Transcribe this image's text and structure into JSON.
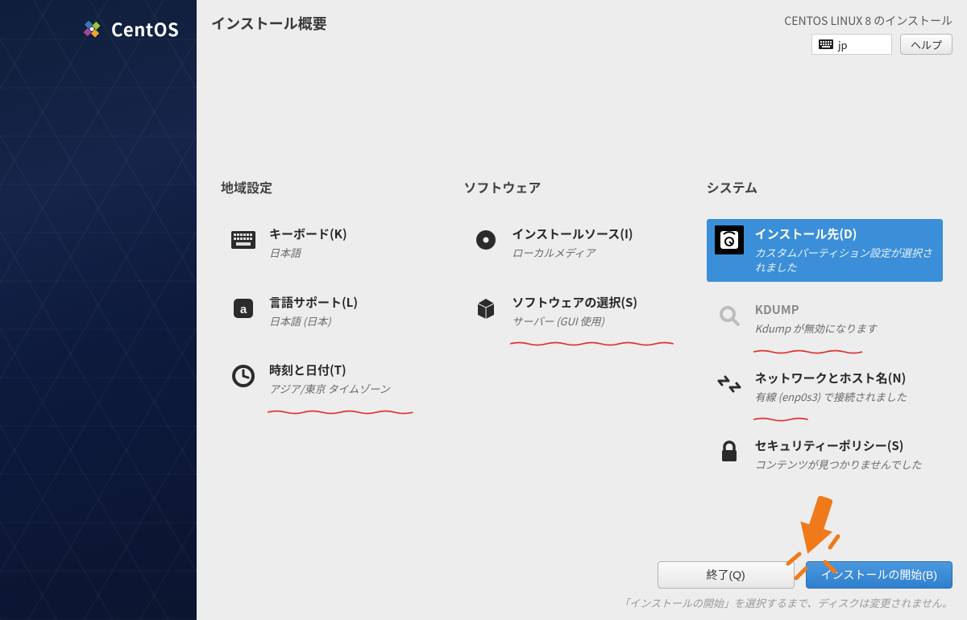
{
  "brand": {
    "name": "CentOS"
  },
  "header": {
    "title": "インストール概要",
    "distro": "CENTOS LINUX 8 のインストール",
    "keyboard_indicator": "jp",
    "help_label": "ヘルプ"
  },
  "columns": {
    "localization": {
      "heading": "地域設定",
      "keyboard": {
        "title": "キーボード(K)",
        "status": "日本語"
      },
      "language": {
        "title": "言語サポート(L)",
        "status": "日本語 (日本)"
      },
      "datetime": {
        "title": "時刻と日付(T)",
        "status": "アジア/東京 タイムゾーン"
      }
    },
    "software": {
      "heading": "ソフトウェア",
      "source": {
        "title": "インストールソース(I)",
        "status": "ローカルメディア"
      },
      "selection": {
        "title": "ソフトウェアの選択(S)",
        "status": "サーバー (GUI 使用)"
      }
    },
    "system": {
      "heading": "システム",
      "destination": {
        "title": "インストール先(D)",
        "status": "カスタムパーティション設定が選択されました"
      },
      "kdump": {
        "title": "KDUMP",
        "status": "Kdump が無効になります"
      },
      "network": {
        "title": "ネットワークとホスト名(N)",
        "status": "有線 (enp0s3) で接続されました"
      },
      "security": {
        "title": "セキュリティーポリシー(S)",
        "status": "コンテンツが見つかりませんでした"
      }
    }
  },
  "footer": {
    "quit_label": "終了(Q)",
    "begin_label": "インストールの開始(B)",
    "hint": "「インストールの開始」を選択するまで、ディスクは変更されません。"
  },
  "colors": {
    "selection_bg": "#3b8fd8",
    "primary_button_bg": "#3a8cd6",
    "annotation": "#f07a1a"
  }
}
